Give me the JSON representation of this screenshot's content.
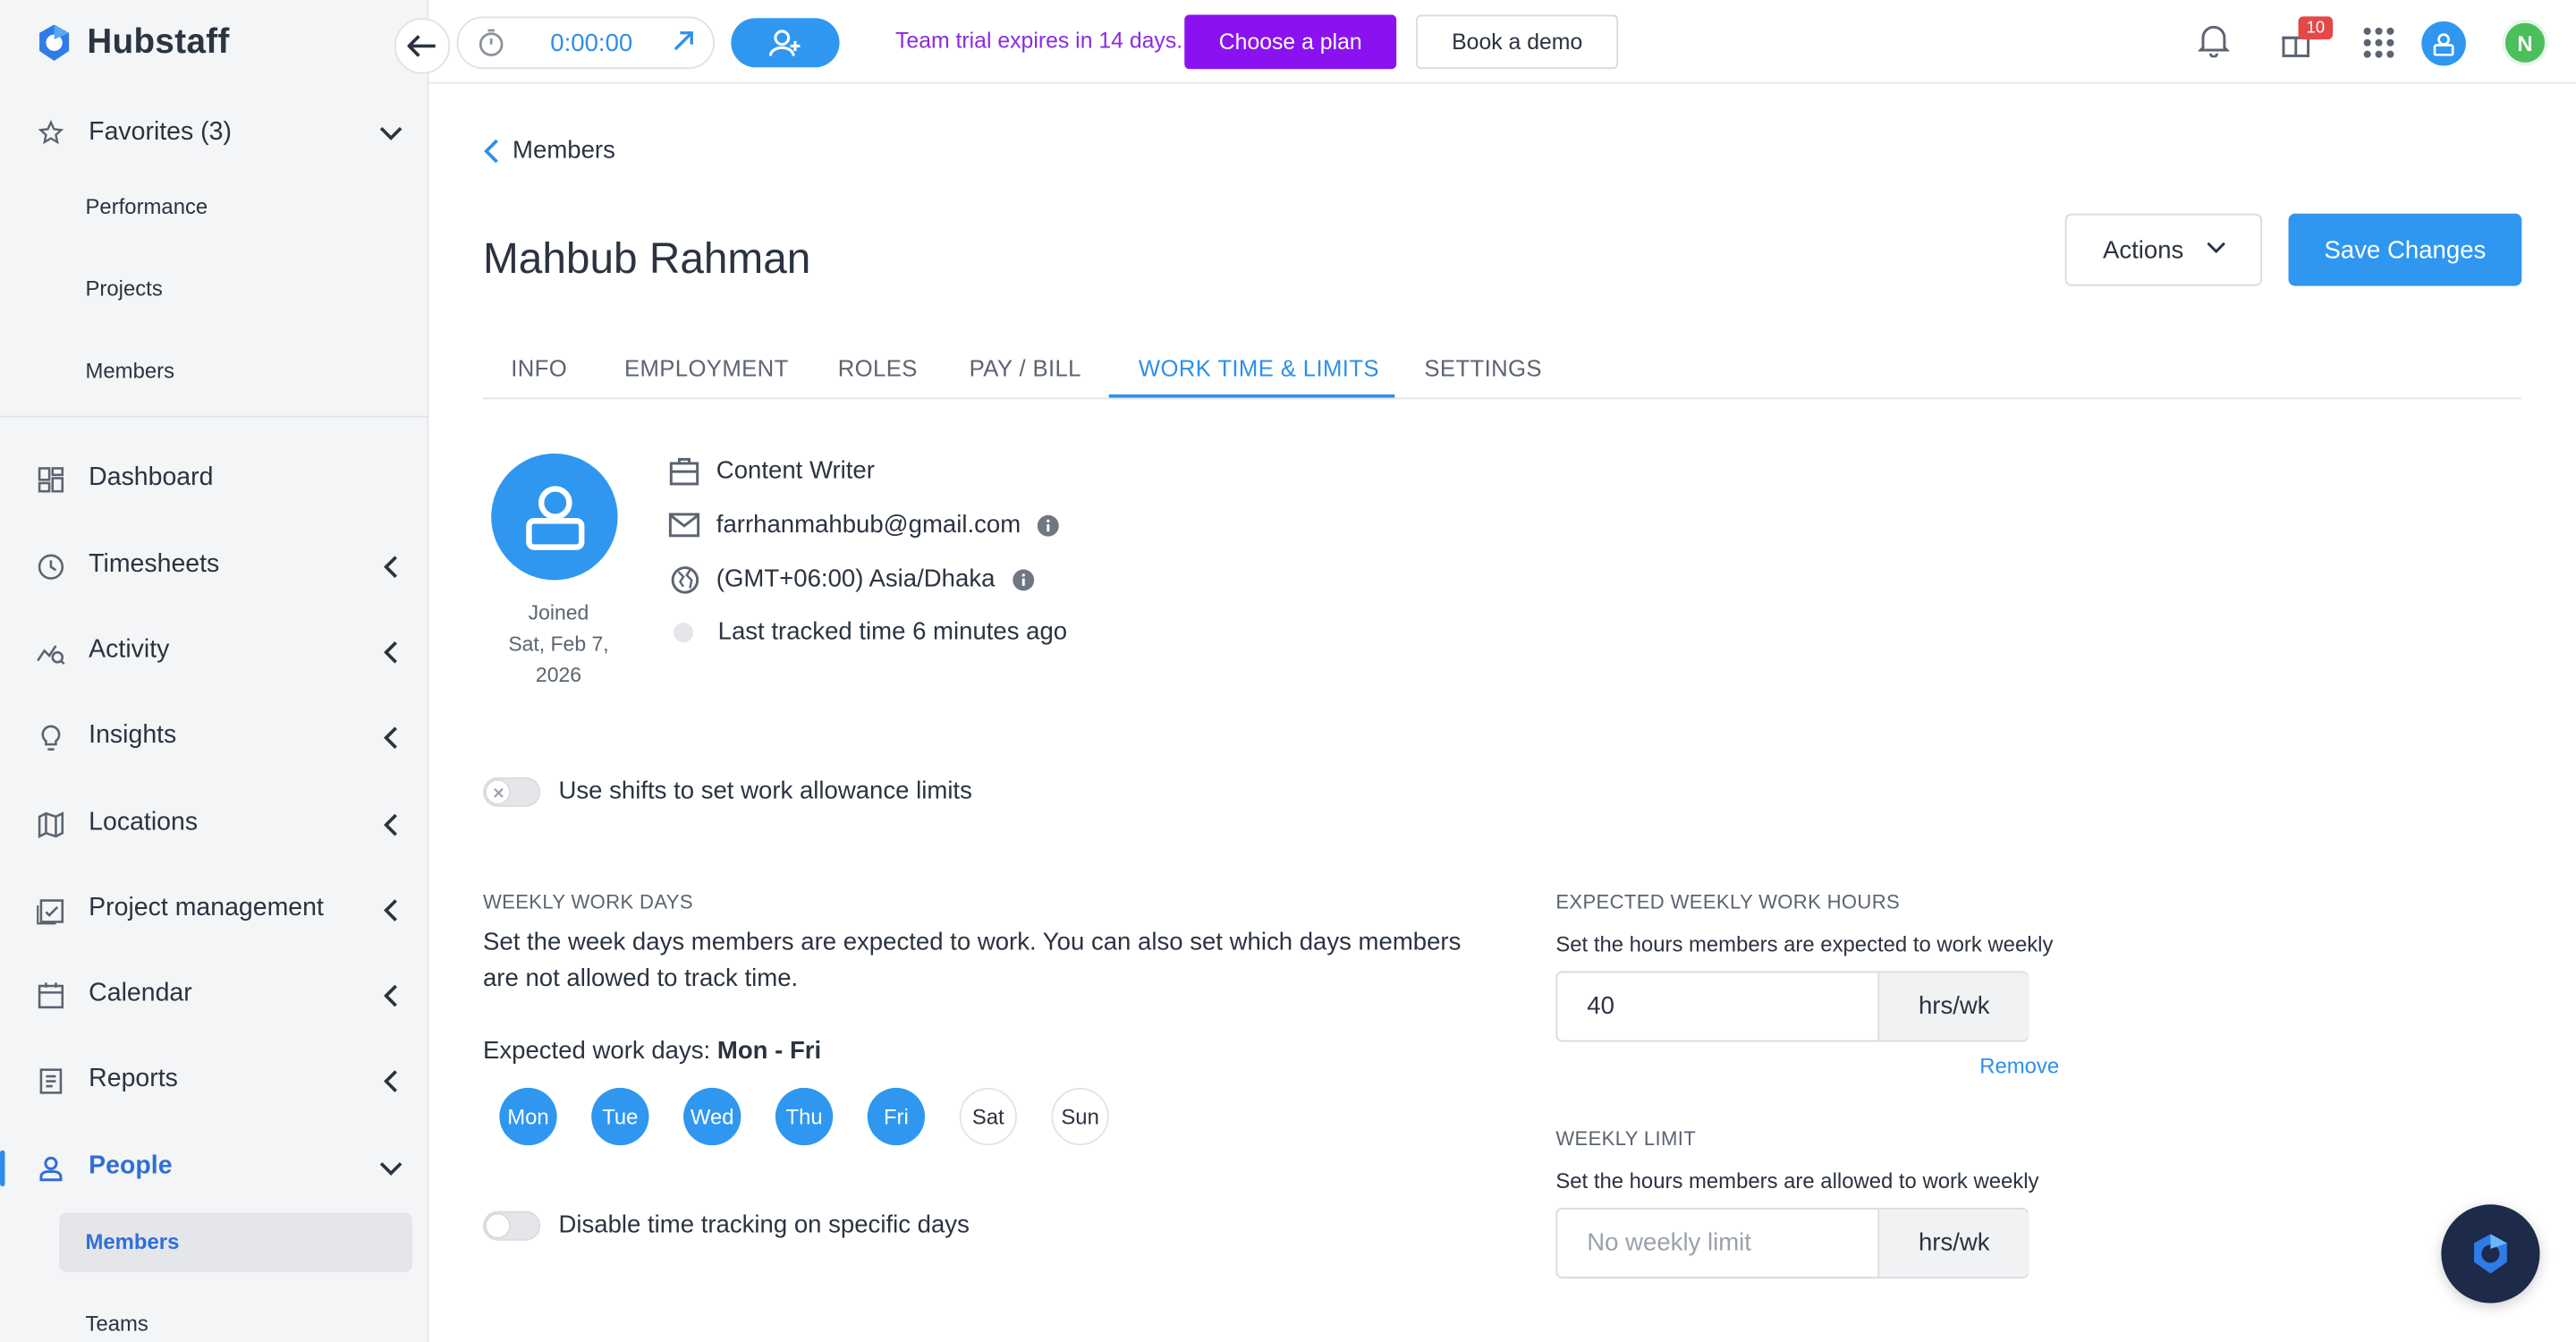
{
  "brand": {
    "name": "Hubstaff"
  },
  "sidebar": {
    "favorites": {
      "label": "Favorites (3)",
      "items": [
        "Performance",
        "Projects",
        "Members"
      ]
    },
    "nav": [
      {
        "label": "Dashboard",
        "icon": "dashboard-icon"
      },
      {
        "label": "Timesheets",
        "icon": "clock-icon"
      },
      {
        "label": "Activity",
        "icon": "activity-icon"
      },
      {
        "label": "Insights",
        "icon": "lightbulb-icon"
      },
      {
        "label": "Locations",
        "icon": "map-icon"
      },
      {
        "label": "Project management",
        "icon": "checklist-icon"
      },
      {
        "label": "Calendar",
        "icon": "calendar-icon"
      },
      {
        "label": "Reports",
        "icon": "report-icon"
      },
      {
        "label": "People",
        "icon": "person-icon"
      }
    ],
    "people_sub": {
      "selected": "Members",
      "next": "Teams"
    }
  },
  "topbar": {
    "timer": "0:00:00",
    "trial_text": "Team trial expires in 14 days.",
    "choose_plan": "Choose a plan",
    "book_demo": "Book a demo",
    "gift_badge": "10",
    "avatar_initial": "N"
  },
  "page": {
    "breadcrumb": "Members",
    "title": "Mahbub Rahman",
    "actions_label": "Actions",
    "save_label": "Save Changes",
    "tabs": [
      "INFO",
      "EMPLOYMENT",
      "ROLES",
      "PAY / BILL",
      "WORK TIME & LIMITS",
      "SETTINGS"
    ],
    "active_tab": "WORK TIME & LIMITS"
  },
  "profile": {
    "joined_label": "Joined",
    "joined_date": "Sat, Feb 7, 2026",
    "role": "Content Writer",
    "email": "farrhanmahbub@gmail.com",
    "timezone": "(GMT+06:00) Asia/Dhaka",
    "last_tracked": "Last tracked time 6 minutes ago"
  },
  "work": {
    "shifts_toggle_label": "Use shifts to set work allowance limits",
    "weekly_days_heading": "WEEKLY WORK DAYS",
    "weekly_days_desc": "Set the week days members are expected to work. You can also set which days members are not allowed to track time.",
    "expected_days_prefix": "Expected work days: ",
    "expected_days_value": "Mon - Fri",
    "days": [
      {
        "label": "Mon",
        "on": true
      },
      {
        "label": "Tue",
        "on": true
      },
      {
        "label": "Wed",
        "on": true
      },
      {
        "label": "Thu",
        "on": true
      },
      {
        "label": "Fri",
        "on": true
      },
      {
        "label": "Sat",
        "on": false
      },
      {
        "label": "Sun",
        "on": false
      }
    ],
    "disable_toggle_label": "Disable time tracking on specific days",
    "expected_hours_heading": "EXPECTED WEEKLY WORK HOURS",
    "expected_hours_desc": "Set the hours members are expected to work weekly",
    "expected_hours_value": "40",
    "unit": "hrs/wk",
    "remove_label": "Remove",
    "weekly_limit_heading": "WEEKLY LIMIT",
    "weekly_limit_desc": "Set the hours members are allowed to work weekly",
    "weekly_limit_placeholder": "No weekly limit"
  },
  "colors": {
    "accent": "#2f97f0",
    "plan": "#8a12f0",
    "trial_text": "#8a2be2",
    "badge": "#e54848"
  }
}
